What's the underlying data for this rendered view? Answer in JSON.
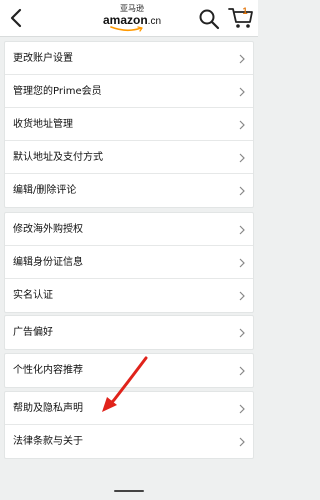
{
  "header": {
    "logo_cn": "亚马逊",
    "logo_en": "amazon",
    "logo_suffix": ".cn",
    "cart_count": "1"
  },
  "colors": {
    "brand_orange": "#ff9900",
    "background": "#eef0f0",
    "annotation_arrow": "#e0231b"
  },
  "icons": {
    "back": "back-arrow-icon",
    "search": "search-icon",
    "cart": "cart-icon",
    "row": "chevron-right-icon"
  },
  "groups": [
    {
      "items": [
        "更改账户设置",
        "管理您的Prime会员",
        "收货地址管理",
        "默认地址及支付方式",
        "编辑/删除评论"
      ]
    },
    {
      "items": [
        "修改海外购授权",
        "编辑身份证信息",
        "实名认证"
      ]
    },
    {
      "items": [
        "广告偏好"
      ]
    },
    {
      "items": [
        "个性化内容推荐"
      ]
    },
    {
      "items": [
        "帮助及隐私声明",
        "法律条款与关于"
      ]
    }
  ]
}
